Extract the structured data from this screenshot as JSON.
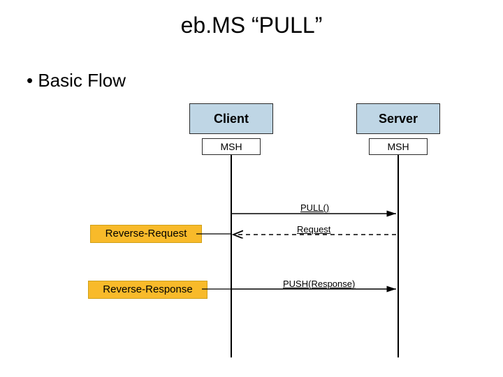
{
  "title": "eb.MS “PULL”",
  "bullet": "• Basic Flow",
  "participants": {
    "client": {
      "label": "Client",
      "msh": "MSH"
    },
    "server": {
      "label": "Server",
      "msh": "MSH"
    }
  },
  "tags": {
    "reverse_request": "Reverse-Request",
    "reverse_response": "Reverse-Response"
  },
  "messages": {
    "pull": "PULL()",
    "request": "Request",
    "push_response": "PUSH(Response)"
  },
  "diagram_data": {
    "type": "sequence",
    "lifelines": [
      "Client MSH",
      "Server MSH"
    ],
    "events": [
      {
        "from": "Client MSH",
        "to": "Server MSH",
        "style": "solid",
        "label": "PULL()"
      },
      {
        "from": "Server MSH",
        "to": "Client MSH",
        "style": "dashed",
        "label": "Request",
        "side_tag": "Reverse-Request"
      },
      {
        "from": "Client MSH",
        "to": "Server MSH",
        "style": "solid",
        "label": "PUSH(Response)",
        "side_tag": "Reverse-Response"
      }
    ]
  }
}
